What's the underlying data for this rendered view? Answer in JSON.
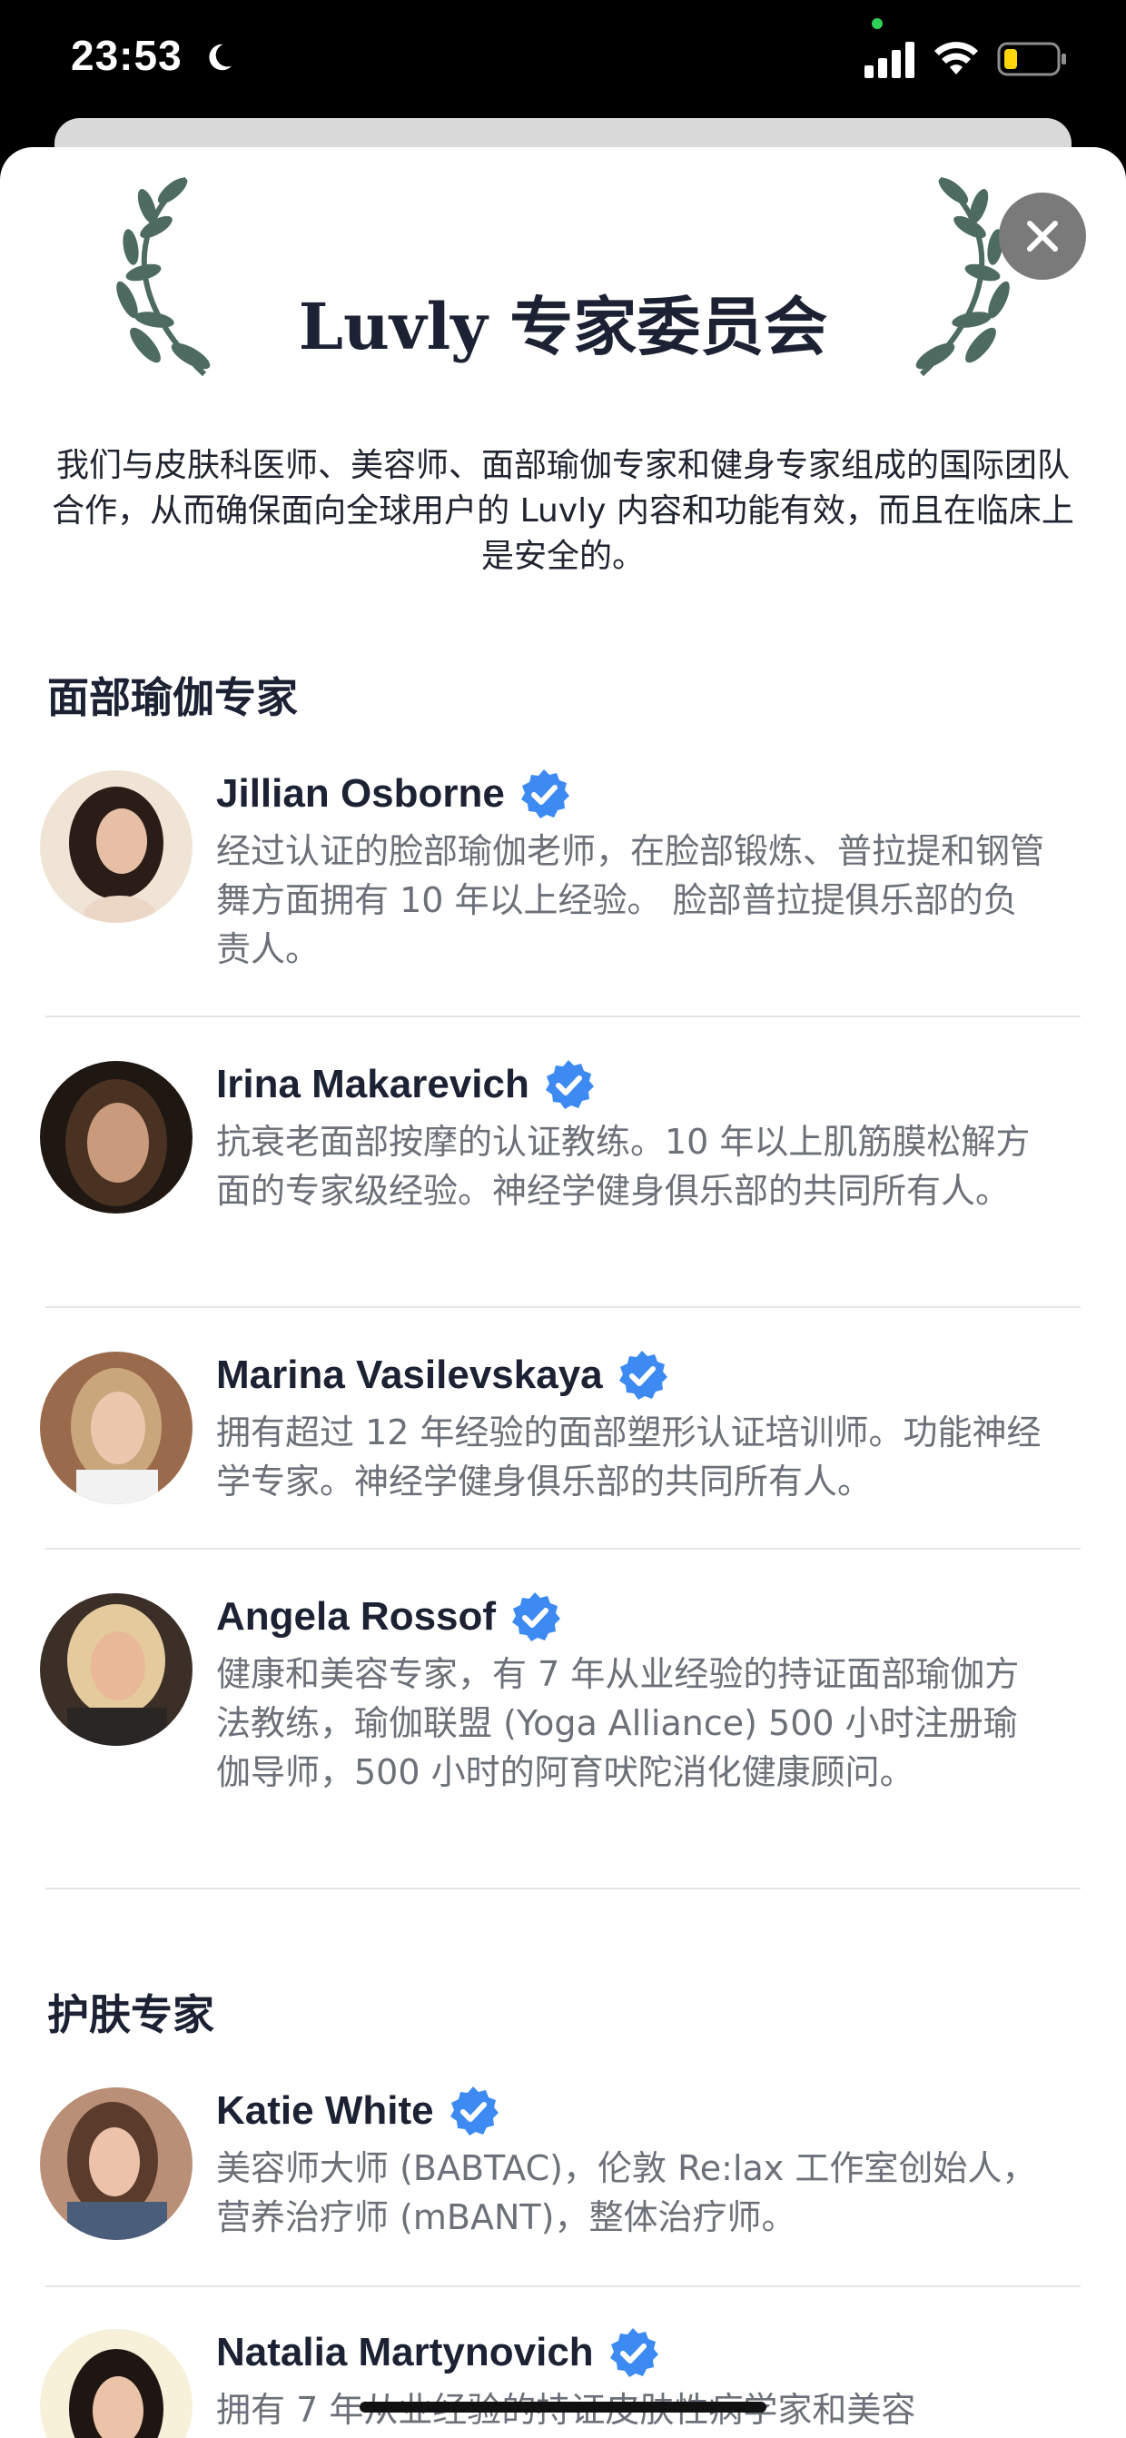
{
  "status_bar": {
    "time": "23:53",
    "icons": [
      "moon-icon",
      "signal-icon",
      "wifi-icon",
      "battery-icon"
    ]
  },
  "header": {
    "title": "Luvly 专家委员会",
    "close_icon": "close-icon",
    "intro": "我们与皮肤科医师、美容师、面部瑜伽专家和健身专家组成的国际团队合作，从而确保面向全球用户的 Luvly 内容和功能有效，而且在临床上是安全的。"
  },
  "sections": [
    {
      "title": "面部瑜伽专家",
      "experts": [
        {
          "name": "Jillian Osborne",
          "desc": "经过认证的脸部瑜伽老师，在脸部锻炼、普拉提和钢管舞方面拥有 10 年以上经验。 脸部普拉提俱乐部的负责人。"
        },
        {
          "name": "Irina Makarevich",
          "desc": "抗衰老面部按摩的认证教练。10 年以上肌筋膜松解方面的专家级经验。神经学健身俱乐部的共同所有人。"
        },
        {
          "name": "Marina Vasilevskaya",
          "desc": "拥有超过 12 年经验的面部塑形认证培训师。功能神经学专家。神经学健身俱乐部的共同所有人。"
        },
        {
          "name": "Angela Rossof",
          "desc": "健康和美容专家，有 7 年从业经验的持证面部瑜伽方法教练，瑜伽联盟 (Yoga Alliance) 500 小时注册瑜伽导师，500 小时的阿育吠陀消化健康顾问。"
        }
      ]
    },
    {
      "title": "护肤专家",
      "experts": [
        {
          "name": "Katie White",
          "desc": "美容师大师 (BABTAC)，伦敦 Re:lax 工作室创始人，营养治疗师 (mBANT)，整体治疗师。"
        },
        {
          "name": "Natalia Martynovich",
          "desc": "拥有 7 年从业经验的持证皮肤性病学家和美容"
        }
      ]
    }
  ],
  "colors": {
    "accent_verified": "#3d8bf2",
    "laurel": "#4e6b62",
    "title": "#1c2233",
    "text_secondary": "#6b7079"
  }
}
